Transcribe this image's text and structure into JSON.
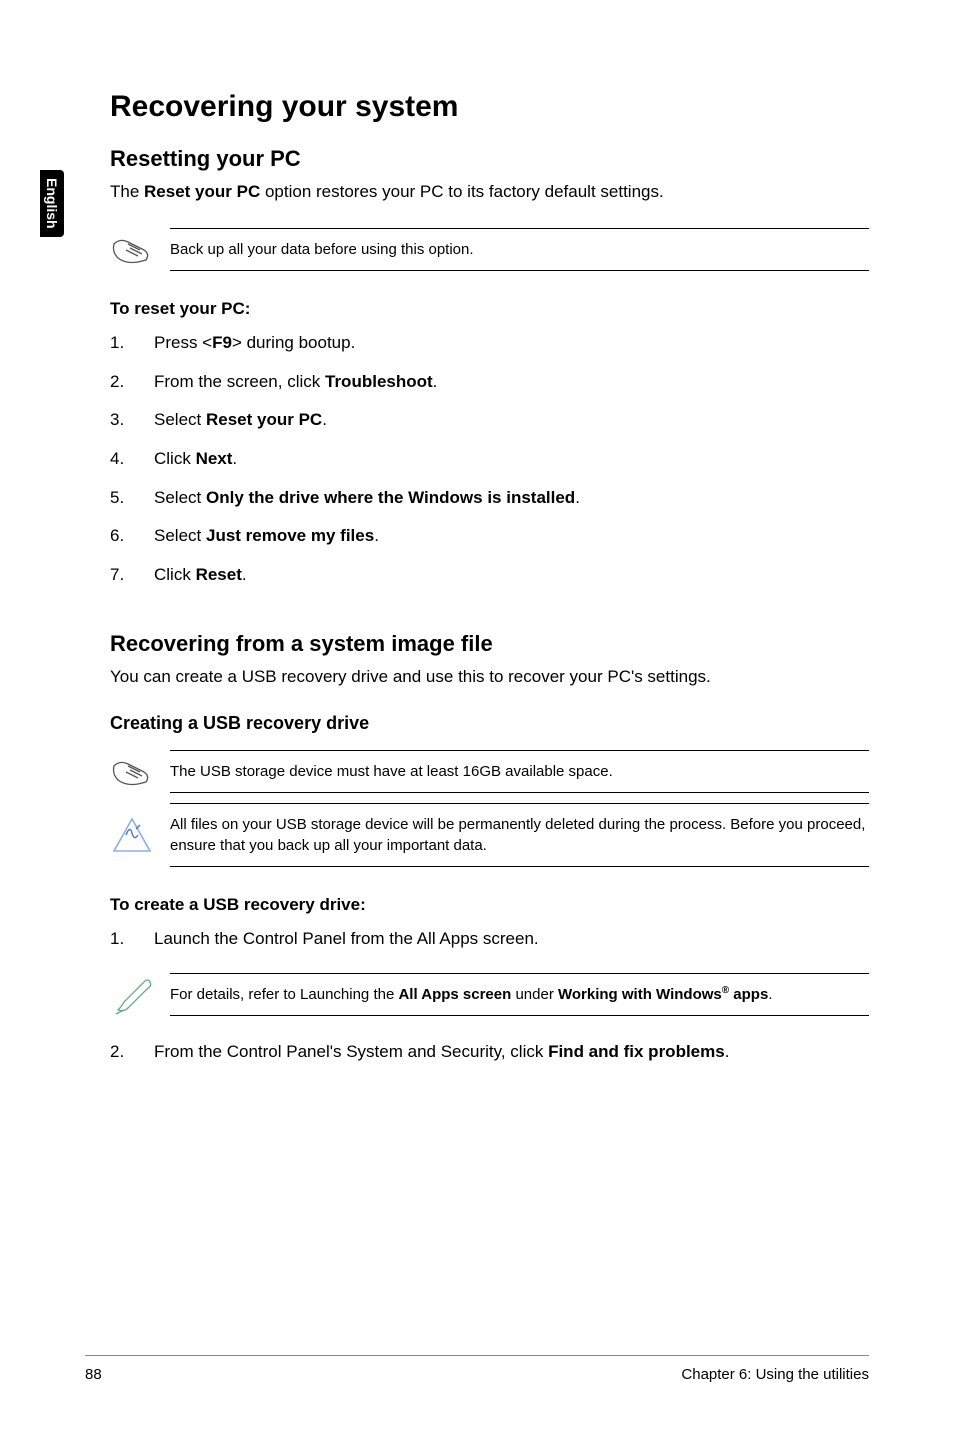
{
  "sideTab": "English",
  "h1": "Recovering your system",
  "section1": {
    "h2": "Resetting your PC",
    "intro_pre": "The ",
    "intro_bold": "Reset your PC",
    "intro_post": " option restores your PC to its factory default settings.",
    "callout": "Back up all your data before using this option.",
    "sub": "To reset your PC:",
    "steps": [
      {
        "n": "1.",
        "pre": "Press <",
        "b": "F9",
        "post": "> during bootup."
      },
      {
        "n": "2.",
        "pre": "From the screen, click ",
        "b": "Troubleshoot",
        "post": "."
      },
      {
        "n": "3.",
        "pre": "Select ",
        "b": "Reset your PC",
        "post": "."
      },
      {
        "n": "4.",
        "pre": "Click ",
        "b": "Next",
        "post": "."
      },
      {
        "n": "5.",
        "pre": "Select ",
        "b": "Only the drive where the Windows is installed",
        "post": "."
      },
      {
        "n": "6.",
        "pre": "Select ",
        "b": "Just remove my files",
        "post": "."
      },
      {
        "n": "7.",
        "pre": "Click ",
        "b": "Reset",
        "post": "."
      }
    ]
  },
  "section2": {
    "h2": "Recovering from a system image file",
    "intro": "You can create a USB recovery drive and use this to recover your PC's settings.",
    "h3": "Creating a USB recovery drive",
    "callout1": "The USB storage device must have at least 16GB available space.",
    "callout2": "All files on your USB storage device will be permanently deleted during the process. Before you proceed, ensure that you back up all your important data.",
    "sub": "To create a USB recovery drive:",
    "step1": {
      "n": "1.",
      "text": "Launch the Control Panel from the All Apps screen."
    },
    "callout3_pre": "For details, refer to Launching the ",
    "callout3_b1": "All Apps screen",
    "callout3_mid": " under ",
    "callout3_b2a": "Working with Windows",
    "callout3_b2b": " apps",
    "callout3_post": ".",
    "step2_n": "2.",
    "step2_pre": "From the Control Panel's System and Security, click ",
    "step2_b": "Find and fix problems",
    "step2_post": "."
  },
  "footer": {
    "pageNum": "88",
    "chapter": "Chapter 6: Using the utilities"
  }
}
